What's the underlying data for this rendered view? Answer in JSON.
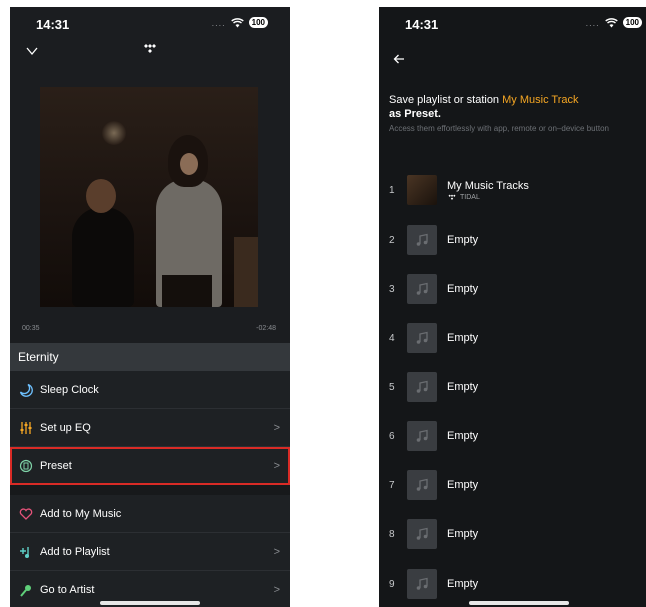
{
  "left": {
    "status_time": "14:31",
    "status_dots": "....",
    "battery": "100",
    "elapsed": "00:35",
    "remaining": "-02:48",
    "menu_title": "Eternity",
    "menu_items": [
      {
        "label": "Sleep Clock",
        "icon": "moon-icon"
      },
      {
        "label": "Set up EQ",
        "icon": "eq-sliders-icon"
      },
      {
        "label": "Preset",
        "icon": "preset-icon"
      },
      {
        "label": "Add to My Music",
        "icon": "heart-icon"
      },
      {
        "label": "Add to Playlist",
        "icon": "add-playlist-icon"
      },
      {
        "label": "Go to Artist",
        "icon": "artist-icon"
      }
    ],
    "arrow": ">"
  },
  "right": {
    "status_time": "14:31",
    "status_dots": "....",
    "battery": "100",
    "title_prefix": "Save playlist or station",
    "title_accent": "My Music Track",
    "title_suffix": "as Preset.",
    "subtitle": "Access them effortlessly with app, remote or on–device button",
    "presets": [
      {
        "num": "1",
        "label": "My Music Tracks",
        "source": "TIDAL"
      },
      {
        "num": "2",
        "label": "Empty"
      },
      {
        "num": "3",
        "label": "Empty"
      },
      {
        "num": "4",
        "label": "Empty"
      },
      {
        "num": "5",
        "label": "Empty"
      },
      {
        "num": "6",
        "label": "Empty"
      },
      {
        "num": "7",
        "label": "Empty"
      },
      {
        "num": "8",
        "label": "Empty"
      },
      {
        "num": "9",
        "label": "Empty"
      }
    ]
  },
  "colors": {
    "accent": "#f5a623",
    "highlight": "#d92b26"
  }
}
